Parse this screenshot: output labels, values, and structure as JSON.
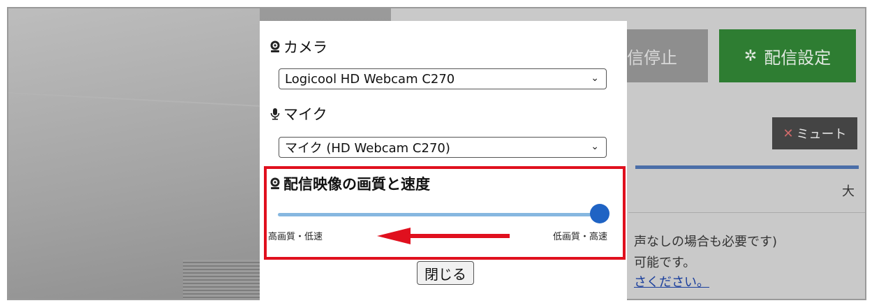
{
  "background": {
    "stop_button": "信停止",
    "settings_button": "配信設定",
    "mute_button": "ミュート",
    "volume_large": "大",
    "line1": "声なしの場合も必要です)",
    "line2": "可能です。",
    "link": "さください。"
  },
  "modal": {
    "camera_label": "カメラ",
    "camera_value": "Logicool HD Webcam C270",
    "mic_label": "マイク",
    "mic_value": "マイク (HD Webcam C270)",
    "quality_label": "配信映像の画質と速度",
    "slider_left": "高画質・低速",
    "slider_right": "低画質・高速",
    "slider_value_fraction": 1.0,
    "close_button": "閉じる"
  },
  "colors": {
    "highlight": "#e0101e",
    "settings_green": "#2e7d32",
    "slider_thumb": "#1f63c4"
  }
}
